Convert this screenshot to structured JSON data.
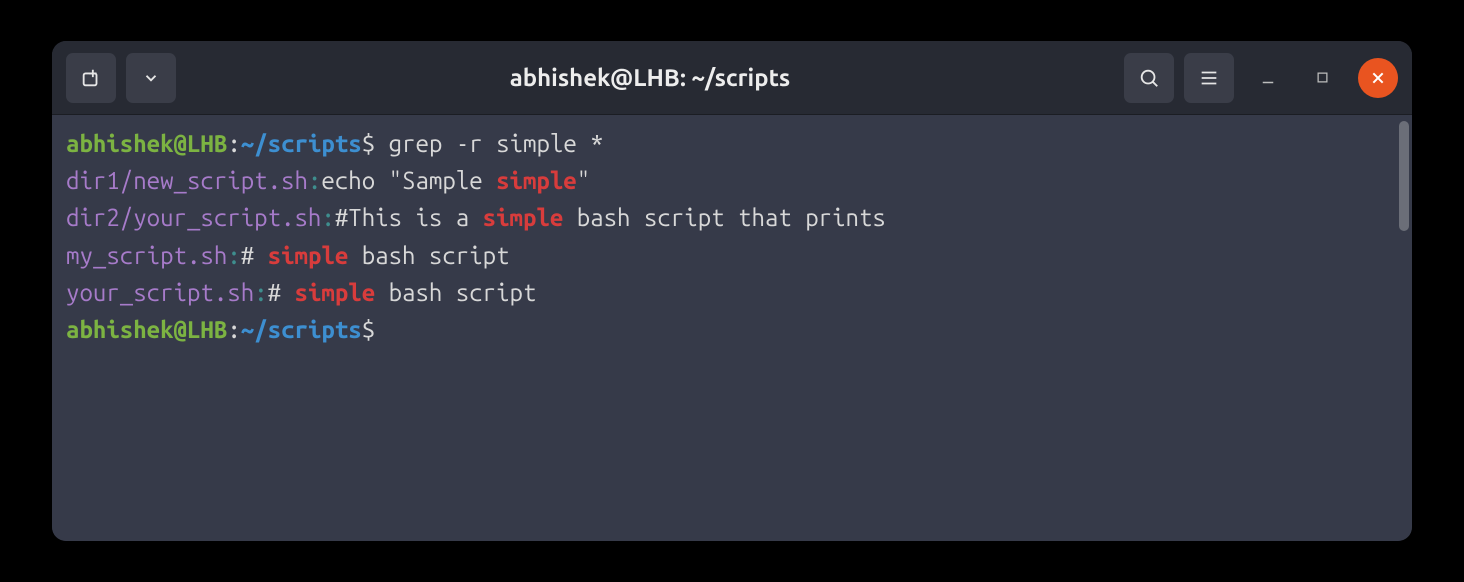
{
  "titlebar": {
    "title": "abhishek@LHB: ~/scripts"
  },
  "prompt": {
    "user": "abhishek",
    "host": "LHB",
    "path": "~/scripts",
    "symbol": "$"
  },
  "command": "grep -r simple *",
  "results": [
    {
      "file": "dir1/new_script.sh",
      "before": "echo \"Sample ",
      "match": "simple",
      "after": "\""
    },
    {
      "file": "dir2/your_script.sh",
      "before": "#This is a ",
      "match": "simple",
      "after": " bash script that prints"
    },
    {
      "file": "my_script.sh",
      "before": "# ",
      "match": "simple",
      "after": " bash script"
    },
    {
      "file": "your_script.sh",
      "before": "# ",
      "match": "simple",
      "after": " bash script"
    }
  ],
  "colors": {
    "bg": "#363a49",
    "user": "#7cb342",
    "path": "#3d8fd1",
    "file": "#a77bca",
    "match": "#d83c3c",
    "close": "#e95420"
  }
}
